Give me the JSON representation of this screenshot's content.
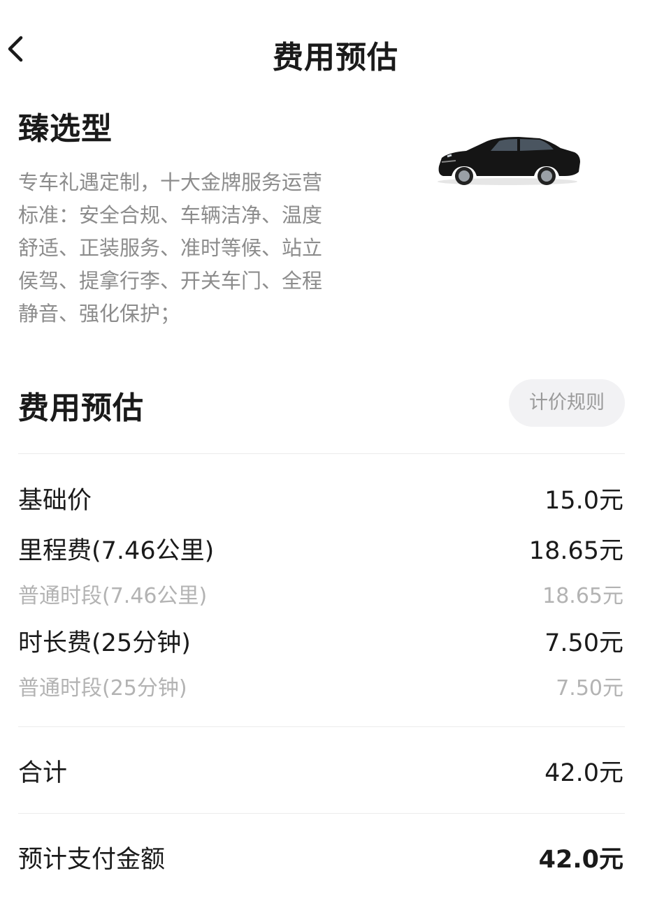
{
  "header": {
    "title": "费用预估"
  },
  "car": {
    "title": "臻选型",
    "description": "专车礼遇定制，十大金牌服务运营标准：安全合规、车辆洁净、温度舒适、正装服务、准时等候、站立侯驾、提拿行李、开关车门、全程静音、强化保护；",
    "icon": "black-sedan"
  },
  "estimate": {
    "title": "费用预估",
    "rule_button": "计价规则"
  },
  "items": {
    "base": {
      "label": "基础价",
      "value": "15.0元"
    },
    "mileage": {
      "label": "里程费(7.46公里)",
      "value": "18.65元"
    },
    "mileage_normal": {
      "label": "普通时段(7.46公里)",
      "value": "18.65元"
    },
    "duration": {
      "label": "时长费(25分钟)",
      "value": "7.50元"
    },
    "duration_normal": {
      "label": "普通时段(25分钟)",
      "value": "7.50元"
    }
  },
  "total": {
    "label": "合计",
    "value": "42.0元"
  },
  "payment": {
    "label": "预计支付金额",
    "value": "42.0元"
  },
  "colors": {
    "primary_text": "#1a1a1a",
    "secondary_text": "#8c8c8c",
    "tertiary_text": "#b3b3b3",
    "button_bg": "#f2f2f4"
  }
}
